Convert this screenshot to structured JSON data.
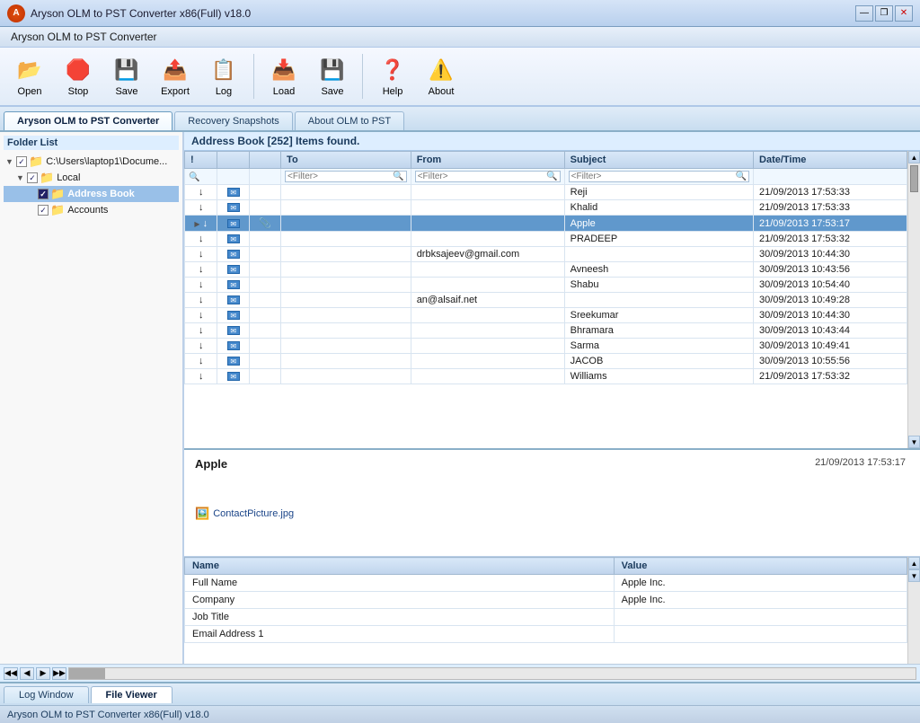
{
  "app": {
    "title": "Aryson OLM to PST Converter x86(Full) v18.0",
    "status": "Aryson OLM to PST Converter x86(Full) v18.0"
  },
  "menubar": {
    "app_name": "Aryson OLM to PST Converter"
  },
  "toolbar": {
    "open_label": "Open",
    "stop_label": "Stop",
    "save_label": "Save",
    "export_label": "Export",
    "log_label": "Log",
    "load_label": "Load",
    "save2_label": "Save",
    "help_label": "Help",
    "about_label": "About"
  },
  "tabs": {
    "converter": "Aryson OLM to PST Converter",
    "recovery": "Recovery Snapshots",
    "about": "About OLM to PST"
  },
  "folder_list": {
    "header": "Folder List",
    "path": "C:\\Users\\laptop1\\Docume...",
    "local": "Local",
    "address_book": "Address Book",
    "accounts": "Accounts"
  },
  "email_list": {
    "header": "Address Book [252] Items found.",
    "columns": {
      "flag": "!",
      "type": "",
      "attachment": "",
      "to": "To",
      "from": "From",
      "subject": "Subject",
      "datetime": "Date/Time"
    },
    "filter": {
      "to_placeholder": "<Filter>",
      "from_placeholder": "<Filter>",
      "subject_placeholder": "<Filter>"
    },
    "rows": [
      {
        "flag": "↓",
        "type": "📧",
        "attach": "",
        "to": "",
        "from": "",
        "subject": "Reji",
        "datetime": "21/09/2013 17:53:33"
      },
      {
        "flag": "↓",
        "type": "📧",
        "attach": "",
        "to": "",
        "from": "",
        "subject": "Khalid",
        "datetime": "21/09/2013 17:53:33"
      },
      {
        "flag": "↓",
        "type": "📧",
        "attach": "📎",
        "to": "",
        "from": "",
        "subject": "Apple",
        "datetime": "21/09/2013 17:53:17",
        "selected": true
      },
      {
        "flag": "↓",
        "type": "📧",
        "attach": "",
        "to": "",
        "from": "",
        "subject": "PRADEEP",
        "datetime": "21/09/2013 17:53:32"
      },
      {
        "flag": "↓",
        "type": "📧",
        "attach": "",
        "to": "",
        "from": "drbksajeev@gmail.com",
        "subject": "",
        "datetime": "30/09/2013 10:44:30"
      },
      {
        "flag": "↓",
        "type": "📧",
        "attach": "",
        "to": "",
        "from": "",
        "subject": "Avneesh",
        "datetime": "30/09/2013 10:43:56"
      },
      {
        "flag": "↓",
        "type": "📧",
        "attach": "",
        "to": "",
        "from": "",
        "subject": "Shabu",
        "datetime": "30/09/2013 10:54:40"
      },
      {
        "flag": "↓",
        "type": "📧",
        "attach": "",
        "to": "",
        "from": "an@alsaif.net",
        "subject": "",
        "datetime": "30/09/2013 10:49:28"
      },
      {
        "flag": "↓",
        "type": "📧",
        "attach": "",
        "to": "",
        "from": "",
        "subject": "Sreekumar",
        "datetime": "30/09/2013 10:44:30"
      },
      {
        "flag": "↓",
        "type": "📧",
        "attach": "",
        "to": "",
        "from": "",
        "subject": "Bhramara",
        "datetime": "30/09/2013 10:43:44"
      },
      {
        "flag": "↓",
        "type": "📧",
        "attach": "",
        "to": "",
        "from": "",
        "subject": "Sarma",
        "datetime": "30/09/2013 10:49:41"
      },
      {
        "flag": "↓",
        "type": "📧",
        "attach": "",
        "to": "",
        "from": "",
        "subject": "JACOB",
        "datetime": "30/09/2013 10:55:56"
      },
      {
        "flag": "↓",
        "type": "📧",
        "attach": "",
        "to": "",
        "from": "",
        "subject": "Williams",
        "datetime": "21/09/2013 17:53:32"
      }
    ]
  },
  "preview": {
    "sender": "Apple",
    "date": "21/09/2013 17:53:17",
    "attachment": "ContactPicture.jpg"
  },
  "properties": {
    "columns": {
      "name": "Name",
      "value": "Value"
    },
    "rows": [
      {
        "name": "Full Name",
        "value": "Apple Inc."
      },
      {
        "name": "Company",
        "value": "Apple Inc."
      },
      {
        "name": "Job Title",
        "value": ""
      },
      {
        "name": "Email Address 1",
        "value": ""
      }
    ]
  },
  "bottom_tabs": {
    "log": "Log Window",
    "viewer": "File Viewer"
  },
  "nav": {
    "first": "◀◀",
    "prev": "◀",
    "next": "▶",
    "last": "▶▶"
  },
  "window_controls": {
    "minimize": "—",
    "maximize": "❐",
    "close": "✕"
  }
}
